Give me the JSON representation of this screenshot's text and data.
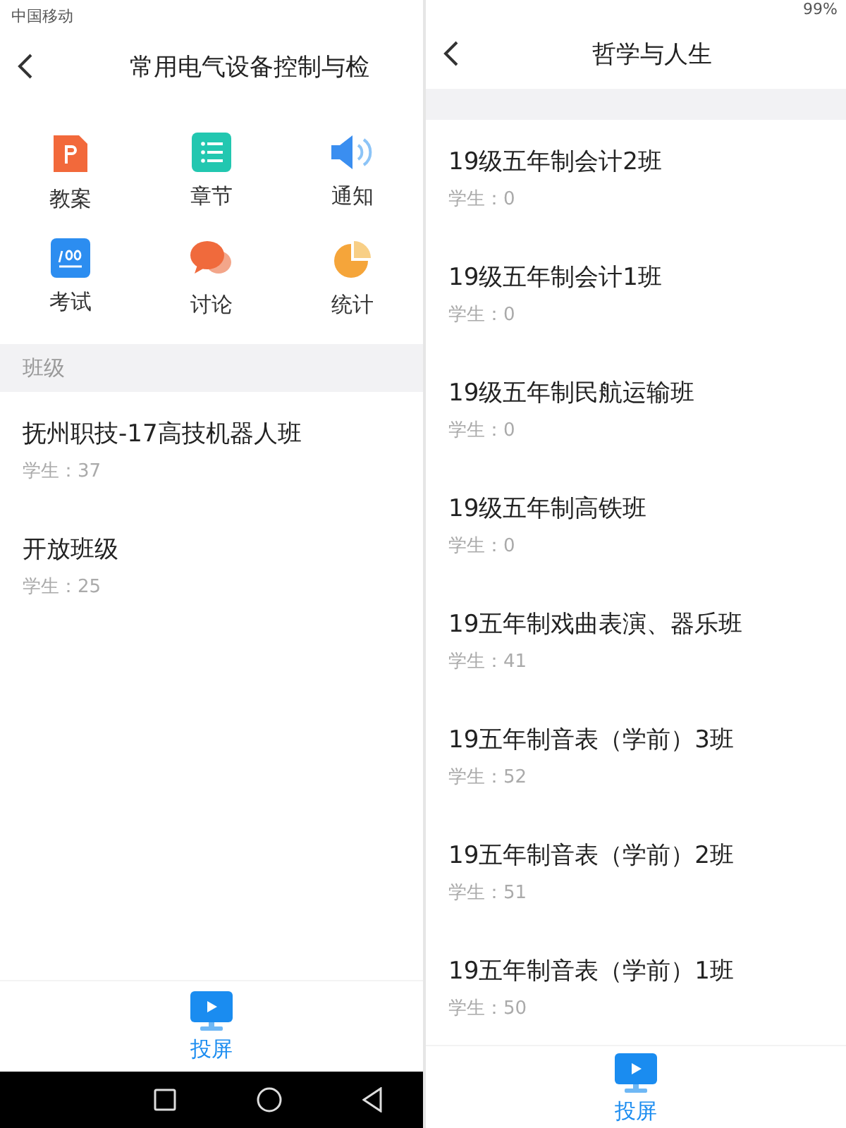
{
  "left_screen": {
    "status_bar": {
      "carrier": "中国移动"
    },
    "title": "常用电气设备控制与检",
    "features": [
      {
        "kind": "lesson",
        "label": "教案"
      },
      {
        "kind": "chapter",
        "label": "章节"
      },
      {
        "kind": "notice",
        "label": "通知"
      },
      {
        "kind": "exam",
        "label": "考试"
      },
      {
        "kind": "discussion",
        "label": "讨论"
      },
      {
        "kind": "stats",
        "label": "统计"
      }
    ],
    "section_header": "班级",
    "classes": [
      {
        "name": "抚州职技-17高技机器人班",
        "students": "学生：37"
      },
      {
        "name": "开放班级",
        "students": "学生：25"
      }
    ],
    "bottom_tab": {
      "label": "投屏"
    }
  },
  "right_screen": {
    "status_bar": {
      "battery": "99%"
    },
    "title": "哲学与人生",
    "classes": [
      {
        "name": "19级五年制会计2班",
        "students": "学生：0"
      },
      {
        "name": "19级五年制会计1班",
        "students": "学生：0"
      },
      {
        "name": "19级五年制民航运输班",
        "students": "学生：0"
      },
      {
        "name": "19级五年制高铁班",
        "students": "学生：0"
      },
      {
        "name": "19五年制戏曲表演、器乐班",
        "students": "学生：41"
      },
      {
        "name": "19五年制音表（学前）3班",
        "students": "学生：52"
      },
      {
        "name": "19五年制音表（学前）2班",
        "students": "学生：51"
      },
      {
        "name": "19五年制音表（学前）1班",
        "students": "学生：50"
      }
    ],
    "bottom_tab": {
      "label": "投屏"
    }
  }
}
